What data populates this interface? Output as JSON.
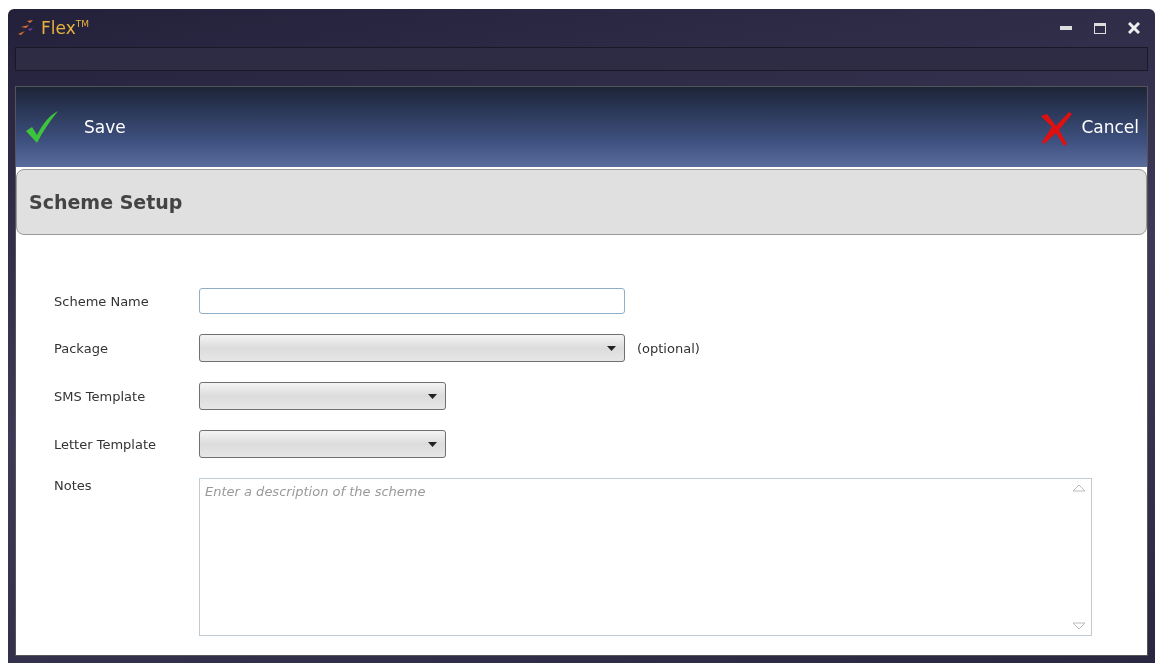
{
  "window": {
    "title": "Flex$^{TM}$"
  },
  "toolbar": {
    "save": "Save",
    "cancel": "Cancel"
  },
  "section": {
    "title": "Scheme Setup"
  },
  "fields": [
    {
      "kind": "text",
      "label": "Scheme Name"
    },
    {
      "kind": "dropdown",
      "label": "Package",
      "hint": "(optional)"
    },
    {
      "kind": "dropdown",
      "label": "SMS Template"
    },
    {
      "kind": "dropdown",
      "label": "Letter Template"
    },
    {
      "kind": "textarea",
      "label": "Notes",
      "placeholder": "Enter a description of the scheme"
    }
  ]
}
